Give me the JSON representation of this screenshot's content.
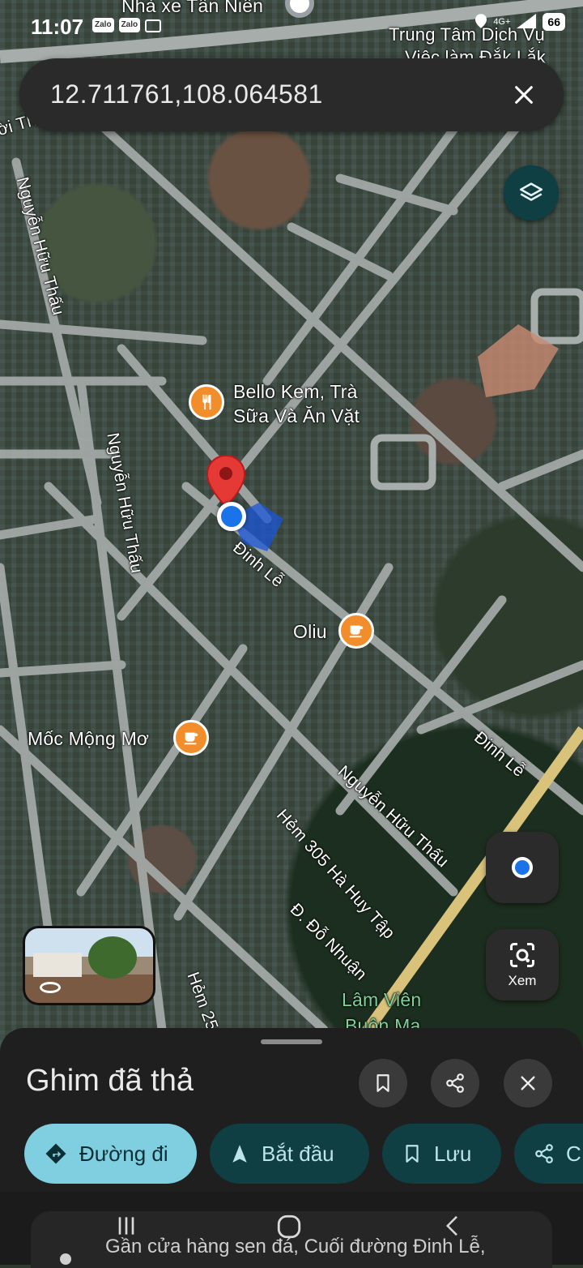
{
  "status_bar": {
    "time": "11:07",
    "apps": [
      "Zalo",
      "Zalo"
    ],
    "network": "4G+",
    "battery": "66"
  },
  "search": {
    "query": "12.711761,108.064581"
  },
  "map": {
    "places": {
      "nha_xe": "Nhà xe Tân Niên",
      "trung_tam": "Trung Tâm Dịch Vụ",
      "trung_tam_2": "Việc làm Đắk Lắk",
      "bello_line1": "Bello Kem, Trà",
      "bello_line2": "Sữa Và Ăn Vặt",
      "oliu": "Oliu",
      "moc_mong_mo": "Mốc Mộng Mơ",
      "lam_vien": "Lâm Viên",
      "buon_ma": "Buôn Ma"
    },
    "streets": {
      "nguyen_huu_thau_1": "Nguyễn Hữu Thấu",
      "nguyen_huu_thau_2": "Nguyễn Hữu Thấu",
      "nguyen_huu_thau_3": "Nguyễn Hữu Thấu",
      "dinh_le_1": "Đinh Lễ",
      "dinh_le_2": "Đinh Lễ",
      "hem_305": "Hẻm 305 Hà Huy Tập",
      "do_nhuan": "Đ. Đỗ Nhuận",
      "hem_25": "Hẻm 25",
      "partial_top_left": "ời Thầ"
    },
    "controls": {
      "layers_icon": "layers-icon",
      "my_location_icon": "my-location-icon",
      "xem_label": "Xem"
    }
  },
  "sheet": {
    "title": "Ghim đã thả",
    "actions": {
      "directions": "Đường đi",
      "start": "Bắt đầu",
      "save": "Lưu",
      "share": "C"
    }
  },
  "bottom": {
    "address_preview": "Gần cửa hàng sen đá, Cuối đường Đinh Lễ,"
  },
  "colors": {
    "pin": "#e53935",
    "location_dot": "#1a73e8",
    "poi": "#f28d2c",
    "chip_primary": "#7fcfe1",
    "chip_secondary": "#0f3e43"
  }
}
